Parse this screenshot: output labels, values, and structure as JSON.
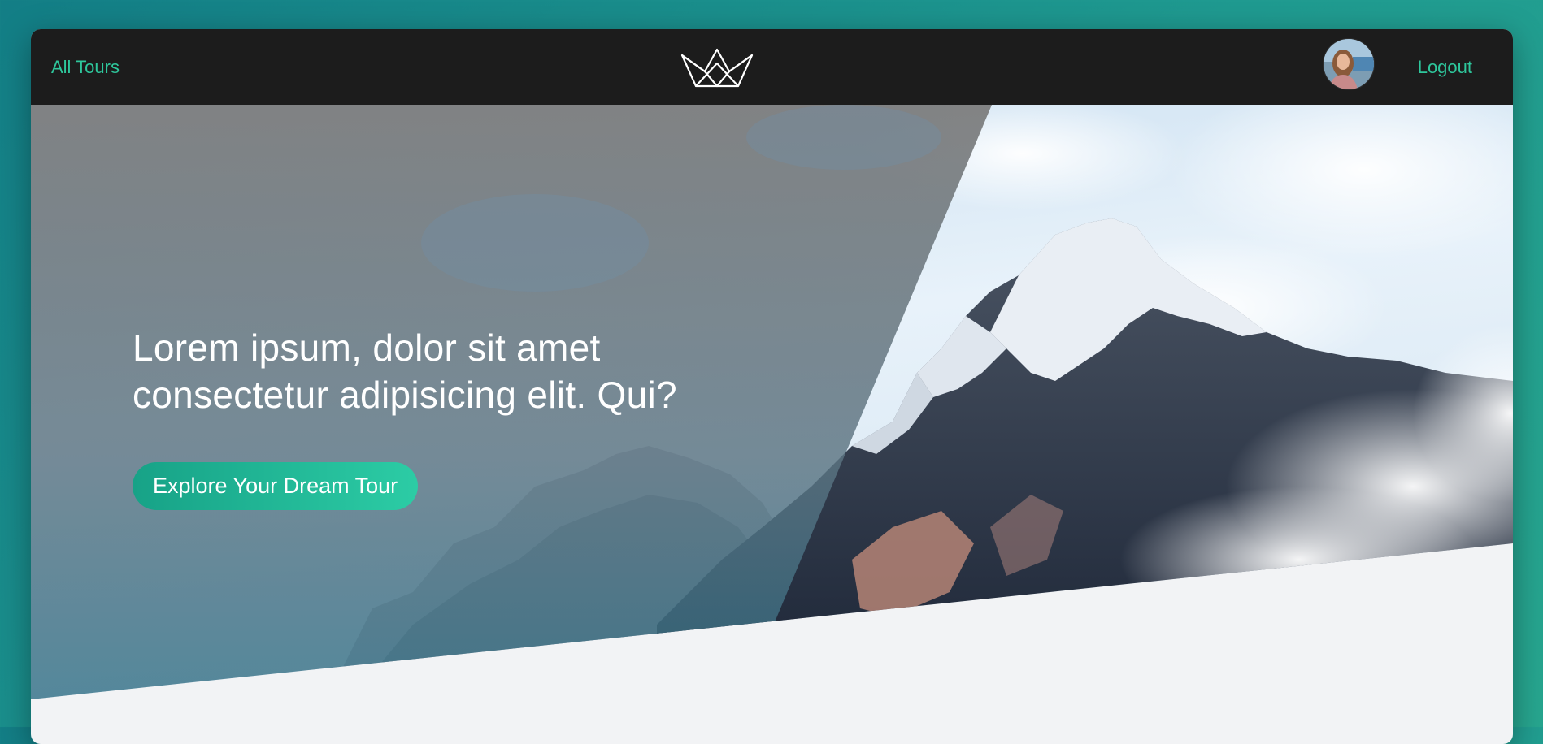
{
  "nav": {
    "all_tours": "All Tours",
    "logout": "Logout",
    "logo_icon": "crown-logo-icon",
    "avatar": "user-avatar"
  },
  "hero": {
    "title_line1": "Lorem ipsum, dolor sit amet",
    "title_line2": "consectetur adipisicing elit. Qui?",
    "cta_label": "Explore Your Dream Tour"
  },
  "colors": {
    "accent": "#2ec79c",
    "navbar": "#1c1c1c",
    "page_bg": "#f2f3f5",
    "outer_bg": "#1a8f8c"
  }
}
